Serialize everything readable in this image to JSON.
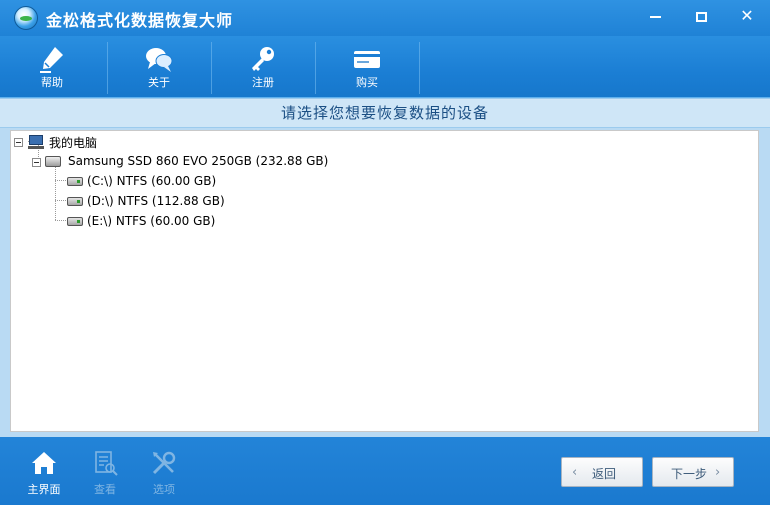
{
  "window": {
    "title": "金松格式化数据恢复大师"
  },
  "toolbar": {
    "items": [
      {
        "label": "帮助",
        "icon": "help-pen-icon"
      },
      {
        "label": "关于",
        "icon": "chat-bubble-icon"
      },
      {
        "label": "注册",
        "icon": "key-icon"
      },
      {
        "label": "购买",
        "icon": "card-icon"
      }
    ]
  },
  "heading": "请选择您想要恢复数据的设备",
  "tree": {
    "root": {
      "label": "我的电脑",
      "icon": "computer-icon"
    },
    "disk": {
      "label": "Samsung SSD 860 EVO 250GB (232.88 GB)",
      "icon": "hard-drive-icon"
    },
    "partitions": [
      {
        "label": "(C:\\) NTFS (60.00 GB)",
        "icon": "partition-icon"
      },
      {
        "label": "(D:\\) NTFS (112.88 GB)",
        "icon": "partition-icon"
      },
      {
        "label": "(E:\\) NTFS (60.00 GB)",
        "icon": "partition-icon"
      }
    ]
  },
  "bottombar": {
    "items": [
      {
        "label": "主界面",
        "icon": "home-icon",
        "enabled": true
      },
      {
        "label": "查看",
        "icon": "view-document-icon",
        "enabled": false
      },
      {
        "label": "选项",
        "icon": "tools-icon",
        "enabled": false
      }
    ],
    "back_label": "返回",
    "next_label": "下一步"
  },
  "colors": {
    "primary": "#1e7fd3",
    "heading_bg": "#cfe6f7",
    "heading_text": "#1b4f84"
  }
}
